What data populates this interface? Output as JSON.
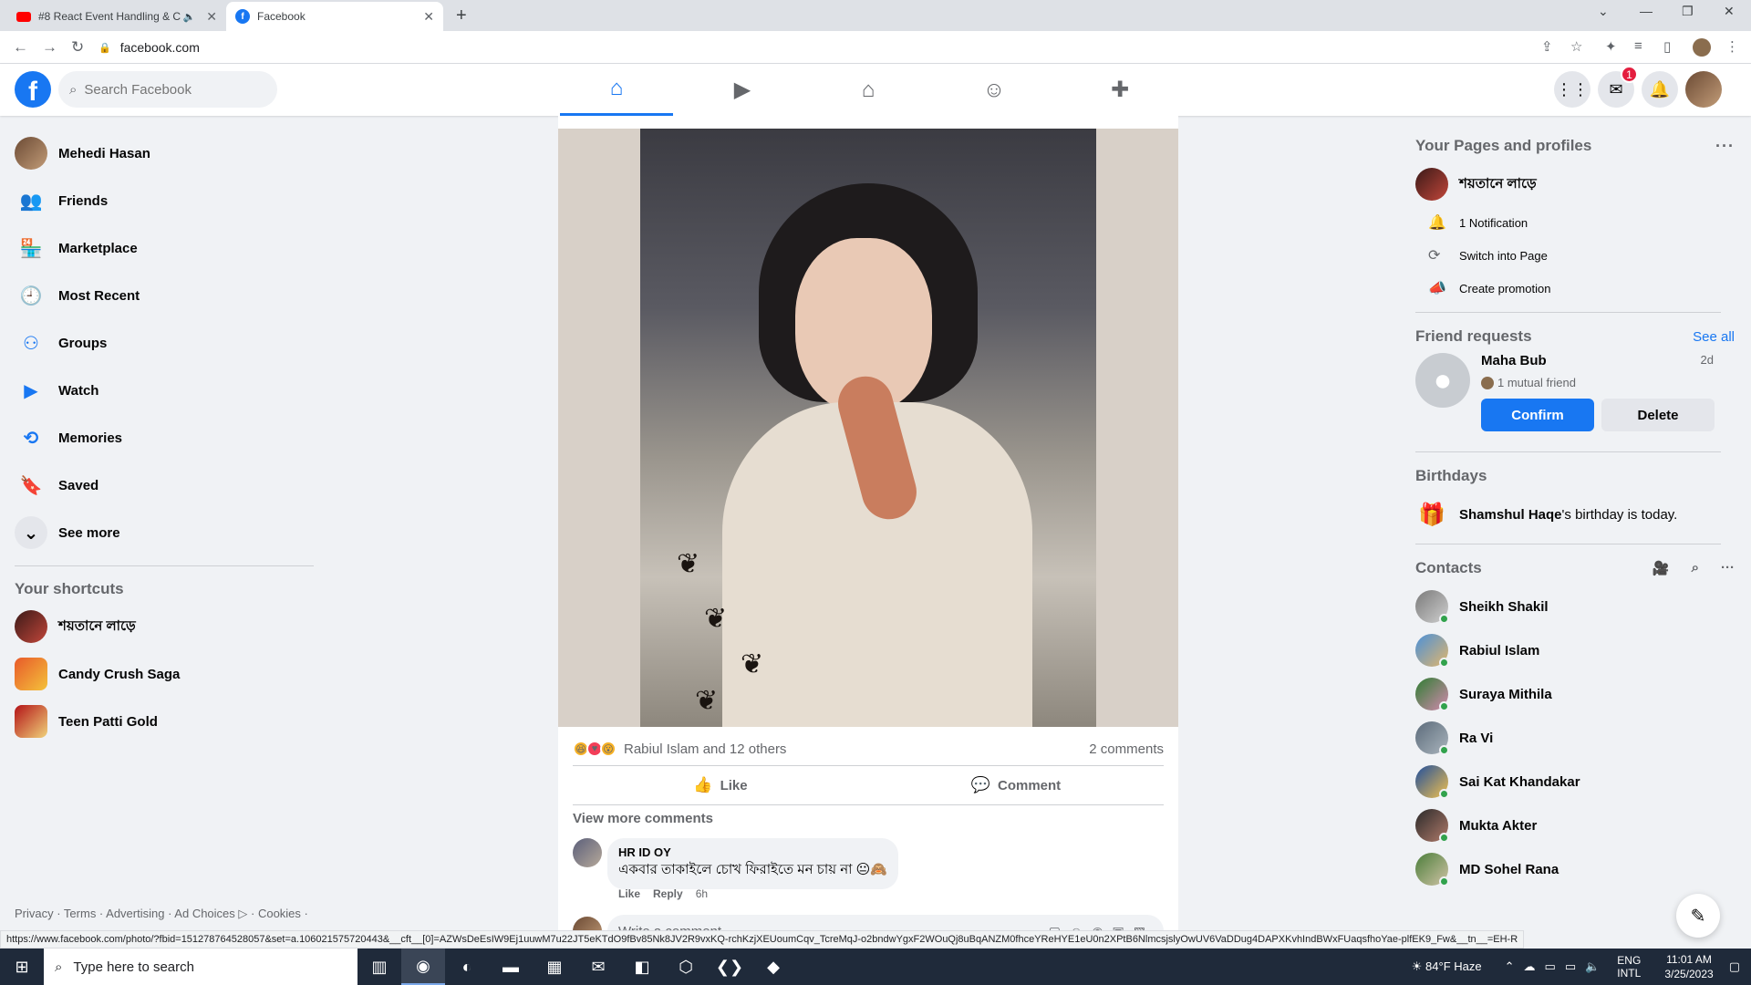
{
  "browser": {
    "tabs": [
      {
        "title": "#8 React Event Handling & C",
        "favicon": "youtube-icon",
        "active": false
      },
      {
        "title": "Facebook",
        "favicon": "facebook-icon",
        "active": true
      }
    ],
    "url": "facebook.com",
    "status_url": "https://www.facebook.com/photo/?fbid=151278764528057&set=a.106021575720443&__cft__[0]=AZWsDeEsIW9Ej1uuwM7u22JT5eKTdO9fBv85Nk8JV2R9vxKQ-rchKzjXEUoumCqv_TcreMqJ-o2bndwYgxF2WOuQj8uBqANZM0fhceYReHYE1eU0n2XPtB6NlmcsjslyOwUV6VaDDug4DAPXKvhIndBWxFUaqsfhoYae-plfEK9_Fw&__tn__=EH-R"
  },
  "header": {
    "search_placeholder": "Search Facebook",
    "messenger_badge": "1",
    "nav": [
      "home-icon",
      "watch-icon",
      "marketplace-icon",
      "groups-icon",
      "gaming-icon"
    ]
  },
  "left": {
    "items": [
      {
        "label": "Mehedi Hasan",
        "icon": "profile-avatar"
      },
      {
        "label": "Friends",
        "icon": "friends-icon"
      },
      {
        "label": "Marketplace",
        "icon": "marketplace-icon"
      },
      {
        "label": "Most Recent",
        "icon": "most-recent-icon"
      },
      {
        "label": "Groups",
        "icon": "groups-icon"
      },
      {
        "label": "Watch",
        "icon": "watch-icon"
      },
      {
        "label": "Memories",
        "icon": "memories-icon"
      },
      {
        "label": "Saved",
        "icon": "saved-icon"
      },
      {
        "label": "See more",
        "icon": "chevron-down-icon"
      }
    ],
    "shortcuts_title": "Your shortcuts",
    "shortcuts": [
      {
        "label": "শয়তানে লাড়ে"
      },
      {
        "label": "Candy Crush Saga"
      },
      {
        "label": "Teen Patti Gold"
      }
    ],
    "footer": "Privacy · Terms · Advertising · Ad Choices ▷ · Cookies ·"
  },
  "post": {
    "reactions_text": "Rabiul Islam and 12 others",
    "comments_count": "2 comments",
    "like_label": "Like",
    "comment_label": "Comment",
    "view_more": "View more comments",
    "comment": {
      "author": "HR ID OY",
      "text": "একবার তাকাইলে চোখ ফিরাইতে মন চায় না 😐🙈",
      "like": "Like",
      "reply": "Reply",
      "time": "6h"
    },
    "write_placeholder": "Write a comment..."
  },
  "right": {
    "pages_title": "Your Pages and profiles",
    "page_name": "শয়তানে লাড়ে",
    "page_actions": [
      {
        "label": "1 Notification",
        "icon": "bell-icon"
      },
      {
        "label": "Switch into Page",
        "icon": "switch-profile-icon"
      },
      {
        "label": "Create promotion",
        "icon": "megaphone-icon"
      }
    ],
    "friend_requests_title": "Friend requests",
    "see_all": "See all",
    "request": {
      "name": "Maha Bub",
      "ago": "2d",
      "mutual": "1 mutual friend",
      "confirm": "Confirm",
      "delete": "Delete"
    },
    "birthdays_title": "Birthdays",
    "birthday_name": "Shamshul Haqe",
    "birthday_rest": "'s birthday is today.",
    "contacts_title": "Contacts",
    "contacts": [
      {
        "name": "Sheikh Shakil"
      },
      {
        "name": "Rabiul Islam"
      },
      {
        "name": "Suraya Mithila"
      },
      {
        "name": "Ra Vi"
      },
      {
        "name": "Sai Kat Khandakar"
      },
      {
        "name": "Mukta Akter"
      },
      {
        "name": "MD Sohel Rana"
      }
    ]
  },
  "taskbar": {
    "search_placeholder": "Type here to search",
    "weather": "84°F Haze",
    "lang_top": "ENG",
    "lang_bottom": "INTL",
    "time": "11:01 AM",
    "date": "3/25/2023"
  }
}
